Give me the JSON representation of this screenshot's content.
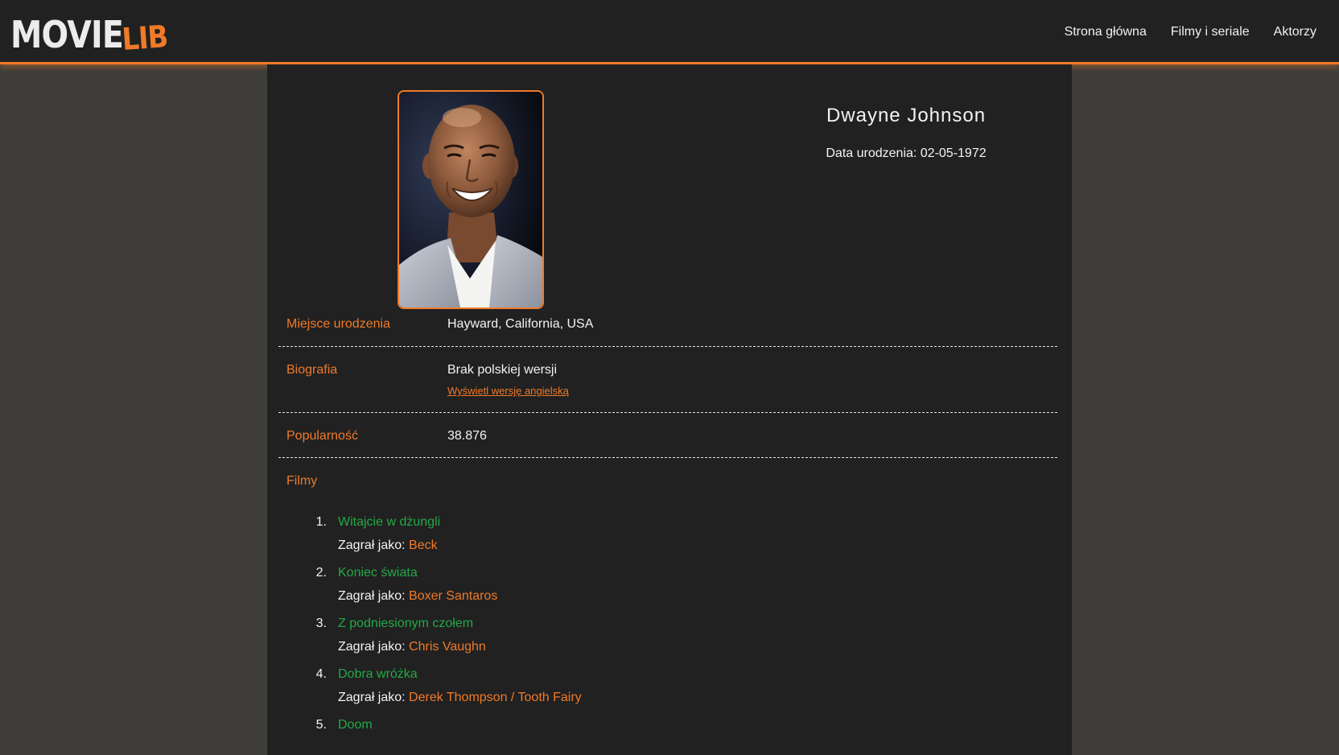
{
  "nav": {
    "logo_primary": "MOVIE",
    "logo_accent": "LIB",
    "links": [
      "Strona główna",
      "Filmy i seriale",
      "Aktorzy"
    ]
  },
  "actor": {
    "name": "Dwayne Johnson",
    "birth_date": "Data urodzenia: 02-05-1972",
    "photo_alt": "Dwayne Johnson"
  },
  "details": {
    "birthplace_label": "Miejsce urodzenia",
    "birthplace_value": "Hayward, California, USA",
    "biography_label": "Biografia",
    "biography_value": "Brak polskiej wersji",
    "biography_link": "Wyświetl wersję angielską",
    "popularity_label": "Popularność",
    "popularity_value": "38.876",
    "films_label": "Filmy"
  },
  "films": [
    {
      "number": "1.",
      "title": "Witajcie w dżungli",
      "role_prefix": "Zagrał jako: ",
      "role": "Beck"
    },
    {
      "number": "2.",
      "title": "Koniec świata",
      "role_prefix": "Zagrał jako: ",
      "role": "Boxer Santaros"
    },
    {
      "number": "3.",
      "title": "Z podniesionym czołem",
      "role_prefix": "Zagrał jako: ",
      "role": "Chris Vaughn"
    },
    {
      "number": "4.",
      "title": "Dobra wróżka",
      "role_prefix": "Zagrał jako: ",
      "role": "Derek Thompson / Tooth Fairy"
    },
    {
      "number": "5.",
      "title": "Doom",
      "role_prefix": "",
      "role": ""
    }
  ],
  "colors": {
    "accent": "#f07a28",
    "film_link": "#24a846",
    "panel": "#212121",
    "page_bg": "#3f3e3a"
  }
}
